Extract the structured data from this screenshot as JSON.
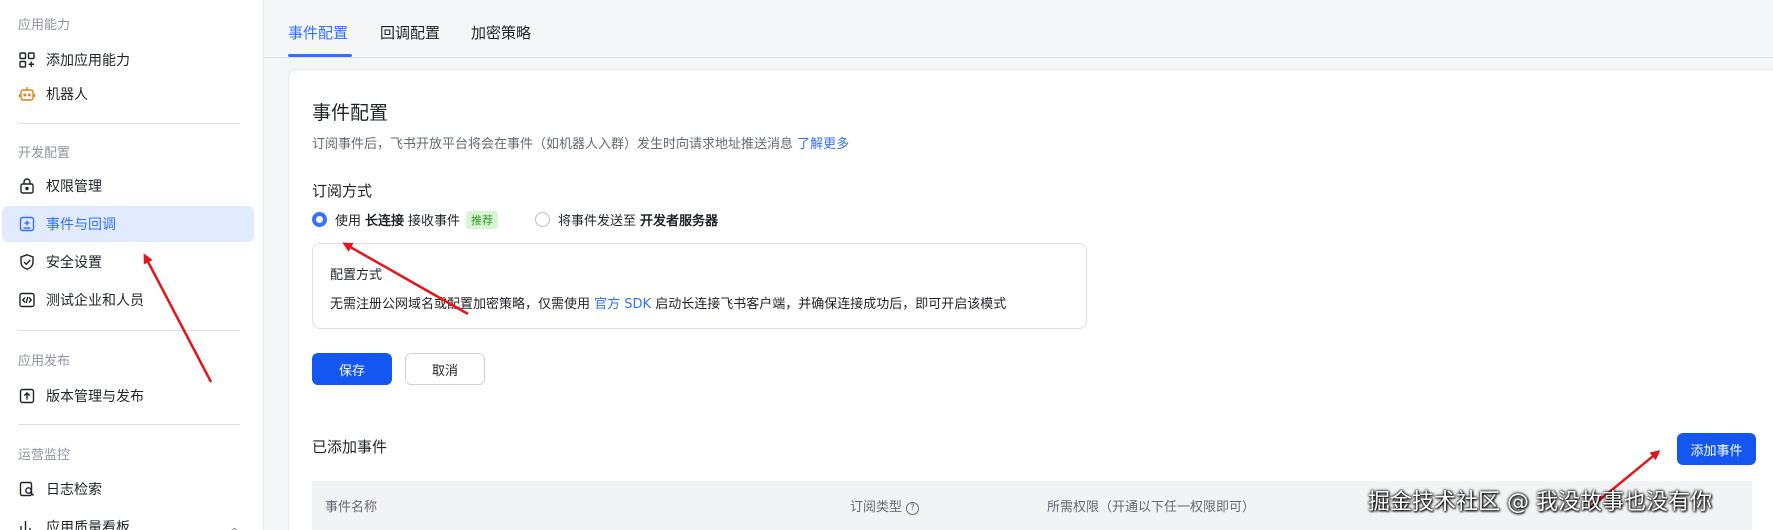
{
  "sidebar": {
    "groups": [
      "应用能力",
      "开发配置",
      "应用发布",
      "运营监控"
    ],
    "items": [
      {
        "label": "添加应用能力",
        "icon": "grid-add-icon"
      },
      {
        "label": "机器人",
        "icon": "robot-icon"
      },
      {
        "label": "权限管理",
        "icon": "lock-icon"
      },
      {
        "label": "事件与回调",
        "icon": "event-plus-icon",
        "active": true
      },
      {
        "label": "安全设置",
        "icon": "shield-icon"
      },
      {
        "label": "测试企业和人员",
        "icon": "code-icon"
      },
      {
        "label": "版本管理与发布",
        "icon": "upload-icon"
      },
      {
        "label": "日志检索",
        "icon": "log-search-icon"
      },
      {
        "label": "应用质量看板",
        "icon": "chart-icon"
      }
    ]
  },
  "tabs": [
    {
      "label": "事件配置",
      "active": true
    },
    {
      "label": "回调配置"
    },
    {
      "label": "加密策略"
    }
  ],
  "main": {
    "title": "事件配置",
    "description": "订阅事件后，飞书开放平台将会在事件（如机器人入群）发生时向请求地址推送消息",
    "learn_more": "了解更多",
    "subscribe_title": "订阅方式",
    "option1": {
      "prefix": "使用",
      "bold": "长连接",
      "suffix": "接收事件",
      "tag": "推荐",
      "selected": true
    },
    "option2": {
      "prefix": "将事件发送至",
      "bold": "开发者服务器",
      "selected": false
    },
    "config_box": {
      "label": "配置方式",
      "text_before": "无需注册公网域名或配置加密策略，仅需使用",
      "link": "官方 SDK",
      "text_after": "启动长连接飞书客户端，并确保连接成功后，即可开启该模式"
    },
    "save_button": "保存",
    "cancel_button": "取消",
    "added_events_title": "已添加事件",
    "add_event_button": "添加事件",
    "table_headers": [
      "事件名称",
      "订阅类型",
      "所需权限（开通以下任一权限即可）"
    ]
  },
  "watermark": "掘金技术社区 @ 我没故事也没有你",
  "colors": {
    "accent": "#3370ff",
    "primary_button": "#1456f0",
    "annotation_arrow": "#e8141a",
    "active_bg": "#e1eaff"
  }
}
